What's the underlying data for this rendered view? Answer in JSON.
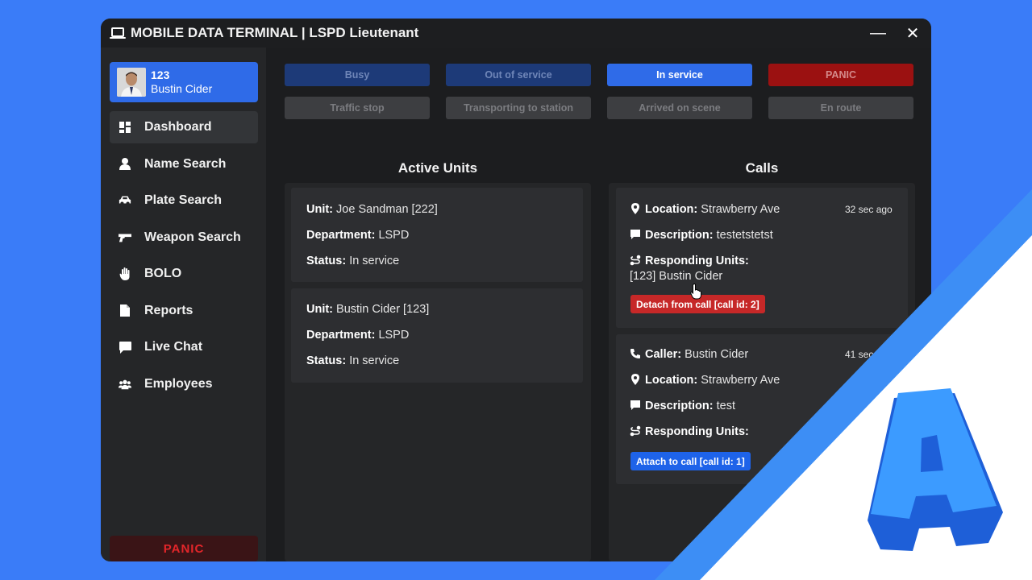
{
  "window": {
    "title": "MOBILE DATA TERMINAL | LSPD Lieutenant",
    "minimize_glyph": "—",
    "close_glyph": "✕"
  },
  "user": {
    "id": "123",
    "name": "Bustin Cider"
  },
  "sidebar": {
    "items": [
      {
        "label": "Dashboard",
        "icon": "dashboard-icon",
        "active": true
      },
      {
        "label": "Name Search",
        "icon": "person-icon"
      },
      {
        "label": "Plate Search",
        "icon": "car-icon"
      },
      {
        "label": "Weapon Search",
        "icon": "gun-icon"
      },
      {
        "label": "BOLO",
        "icon": "hand-icon"
      },
      {
        "label": "Reports",
        "icon": "file-icon"
      },
      {
        "label": "Live Chat",
        "icon": "chat-icon"
      },
      {
        "label": "Employees",
        "icon": "users-icon"
      }
    ],
    "panic_label": "PANIC"
  },
  "status_buttons": {
    "busy": "Busy",
    "out_of_service": "Out of service",
    "in_service": "In service",
    "panic": "PANIC",
    "traffic_stop": "Traffic stop",
    "transporting": "Transporting to station",
    "arrived": "Arrived on scene",
    "en_route": "En route"
  },
  "active_units": {
    "title": "Active Units",
    "labels": {
      "unit": "Unit:",
      "department": "Department:",
      "status": "Status:"
    },
    "units": [
      {
        "unit": "Joe Sandman [222]",
        "department": "LSPD",
        "status": "In service"
      },
      {
        "unit": "Bustin Cider [123]",
        "department": "LSPD",
        "status": "In service"
      }
    ]
  },
  "calls": {
    "title": "Calls",
    "labels": {
      "caller": "Caller:",
      "location": "Location:",
      "description": "Description:",
      "responding": "Responding Units:"
    },
    "items": [
      {
        "time": "32 sec ago",
        "location": "Strawberry Ave",
        "description": "testetstetst",
        "responding": "[123] Bustin Cider",
        "action": "Detach from call [call id: 2]",
        "action_color": "#c62828"
      },
      {
        "time": "41 sec ago",
        "caller": "Bustin Cider",
        "location": "Strawberry Ave",
        "description": "test",
        "responding": "",
        "action": "Attach to call [call id: 1]",
        "action_color": "#1e63e9"
      }
    ]
  },
  "colors": {
    "accent": "#2f6be8",
    "panic": "#9b1111",
    "busy": "#1d3a78",
    "background": "#3a7cf8"
  }
}
